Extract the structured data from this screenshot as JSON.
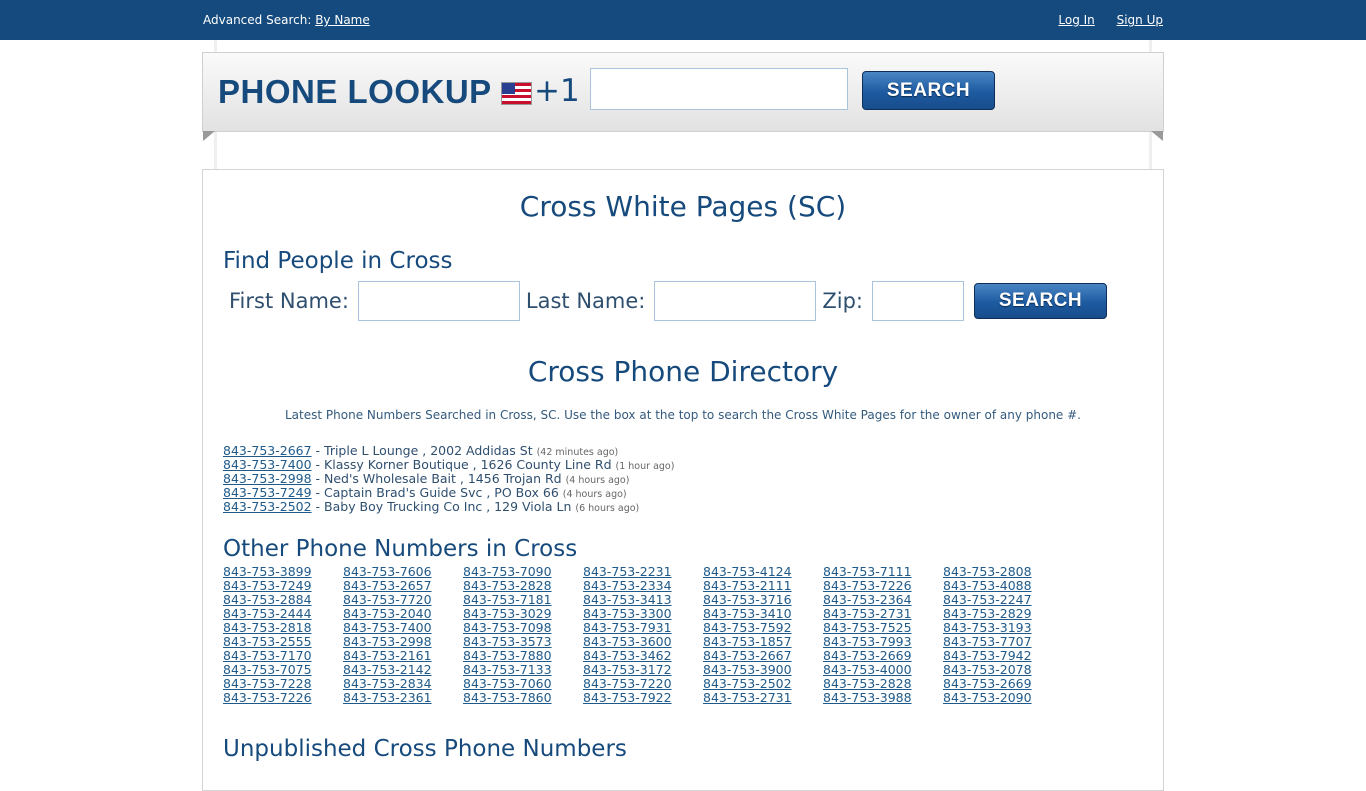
{
  "topbar": {
    "advanced_label": "Advanced Search:",
    "by_name_link": "By Name",
    "login_link": "Log In",
    "signup_link": "Sign Up"
  },
  "header": {
    "logo": "PHONE LOOKUP",
    "country_prefix": "+1",
    "phone_input_value": "",
    "search_label": "SEARCH"
  },
  "page_title": "Cross White Pages (SC)",
  "find_people": {
    "heading": "Find People in Cross",
    "first_name_label": "First Name:",
    "last_name_label": "Last Name:",
    "zip_label": "Zip:",
    "search_label": "SEARCH"
  },
  "directory": {
    "title": "Cross Phone Directory",
    "intro": "Latest Phone Numbers Searched in Cross, SC. Use the box at the top to search the Cross White Pages for the owner of any phone #."
  },
  "recent_searches": [
    {
      "phone": "843-753-2667",
      "detail": " - Triple L Lounge , 2002 Addidas St",
      "ago": "(42 minutes ago)"
    },
    {
      "phone": "843-753-7400",
      "detail": " - Klassy Korner Boutique , 1626 County Line Rd",
      "ago": "(1 hour ago)"
    },
    {
      "phone": "843-753-2998",
      "detail": " - Ned's Wholesale Bait , 1456 Trojan Rd",
      "ago": "(4 hours ago)"
    },
    {
      "phone": "843-753-7249",
      "detail": " - Captain Brad's Guide Svc , PO Box 66",
      "ago": "(4 hours ago)"
    },
    {
      "phone": "843-753-2502",
      "detail": " - Baby Boy Trucking Co Inc , 129 Viola Ln",
      "ago": "(6 hours ago)"
    }
  ],
  "other_numbers": {
    "heading": "Other Phone Numbers in Cross",
    "numbers": [
      "843-753-3899",
      "843-753-7606",
      "843-753-7090",
      "843-753-2231",
      "843-753-4124",
      "843-753-7111",
      "843-753-2808",
      "843-753-7249",
      "843-753-2657",
      "843-753-2828",
      "843-753-2334",
      "843-753-2111",
      "843-753-7226",
      "843-753-4088",
      "843-753-2884",
      "843-753-7720",
      "843-753-7181",
      "843-753-3413",
      "843-753-3716",
      "843-753-2364",
      "843-753-2247",
      "843-753-2444",
      "843-753-2040",
      "843-753-3029",
      "843-753-3300",
      "843-753-3410",
      "843-753-2731",
      "843-753-2829",
      "843-753-2818",
      "843-753-7400",
      "843-753-7098",
      "843-753-7931",
      "843-753-7592",
      "843-753-7525",
      "843-753-3193",
      "843-753-2555",
      "843-753-2998",
      "843-753-3573",
      "843-753-3600",
      "843-753-1857",
      "843-753-7993",
      "843-753-7707",
      "843-753-7170",
      "843-753-2161",
      "843-753-7880",
      "843-753-3462",
      "843-753-2667",
      "843-753-2669",
      "843-753-7942",
      "843-753-7075",
      "843-753-2142",
      "843-753-7133",
      "843-753-3172",
      "843-753-3900",
      "843-753-4000",
      "843-753-2078",
      "843-753-7228",
      "843-753-2834",
      "843-753-7060",
      "843-753-7220",
      "843-753-2502",
      "843-753-2828",
      "843-753-2669",
      "843-753-7226",
      "843-753-2361",
      "843-753-7860",
      "843-753-7922",
      "843-753-2731",
      "843-753-3988",
      "843-753-2090"
    ]
  },
  "unpublished": {
    "heading": "Unpublished Cross Phone Numbers"
  }
}
